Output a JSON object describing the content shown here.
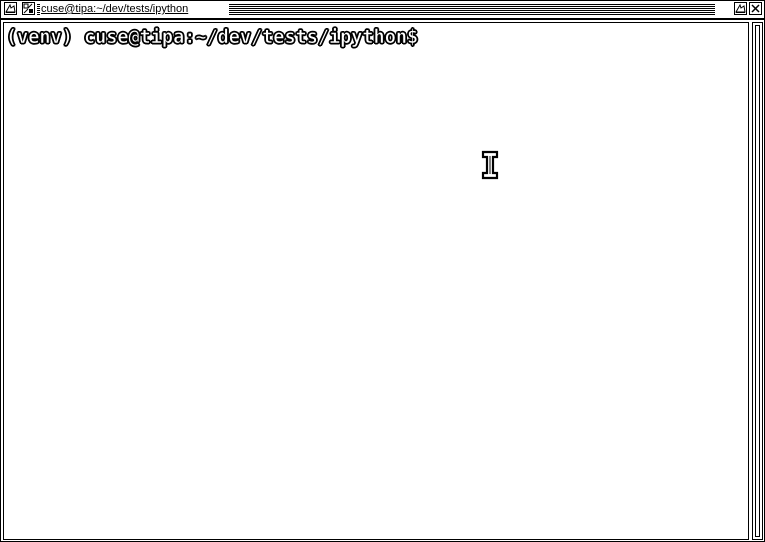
{
  "window": {
    "title": "cuse@tipa:~/dev/tests/ipython"
  },
  "titlebar": {
    "buttons": {
      "menu": "window-menu-icon",
      "sticky": "sticky-icon",
      "iconify": "iconify-icon",
      "close": "close-icon"
    }
  },
  "terminal": {
    "prompt": "(venv) cuse@tipa:~/dev/tests/ipython$",
    "cursor_icon": "text-ibeam-cursor-icon"
  }
}
